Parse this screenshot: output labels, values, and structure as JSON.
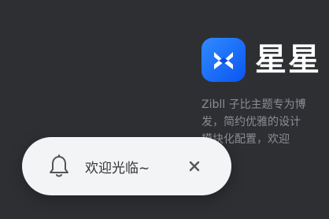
{
  "brand": {
    "name": "星星",
    "icon": "x-logo-icon",
    "accent_color": "#1a6dff"
  },
  "description": {
    "lines": [
      "Zibll 子比主题专为博",
      "发，简约优雅的设计",
      "模块化配置，欢迎"
    ]
  },
  "toast": {
    "message": "欢迎光临~",
    "icon": "bell-icon",
    "close_icon": "close-icon"
  }
}
